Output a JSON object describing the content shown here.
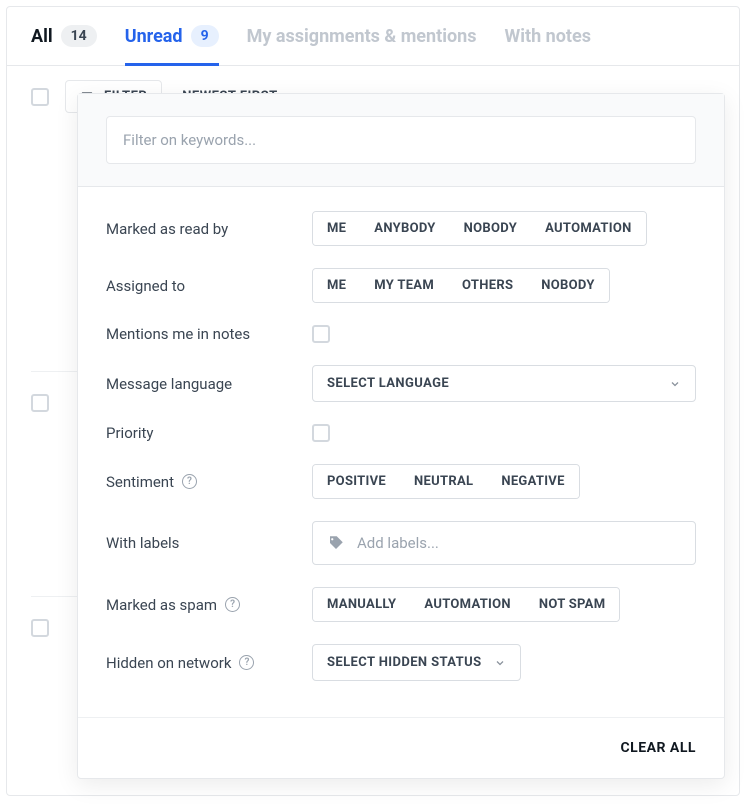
{
  "tabs": {
    "all": {
      "label": "All",
      "count": "14"
    },
    "unread": {
      "label": "Unread",
      "count": "9"
    },
    "assignments": {
      "label": "My assignments & mentions"
    },
    "notes": {
      "label": "With notes"
    }
  },
  "toolbar": {
    "filter_label": "FILTER",
    "sort_label": "NEWEST FIRST"
  },
  "filter_panel": {
    "search_placeholder": "Filter on keywords...",
    "marked_read_label": "Marked as read by",
    "marked_read_options": [
      "ME",
      "ANYBODY",
      "NOBODY",
      "AUTOMATION"
    ],
    "assigned_label": "Assigned to",
    "assigned_options": [
      "ME",
      "MY TEAM",
      "OTHERS",
      "NOBODY"
    ],
    "mentions_label": "Mentions me in notes",
    "language_label": "Message language",
    "language_select": "SELECT LANGUAGE",
    "priority_label": "Priority",
    "sentiment_label": "Sentiment",
    "sentiment_options": [
      "POSITIVE",
      "NEUTRAL",
      "NEGATIVE"
    ],
    "with_labels_label": "With labels",
    "with_labels_placeholder": "Add labels...",
    "spam_label": "Marked as spam",
    "spam_options": [
      "MANUALLY",
      "AUTOMATION",
      "NOT SPAM"
    ],
    "hidden_label": "Hidden on network",
    "hidden_select": "SELECT HIDDEN STATUS",
    "clear_label": "CLEAR ALL"
  }
}
